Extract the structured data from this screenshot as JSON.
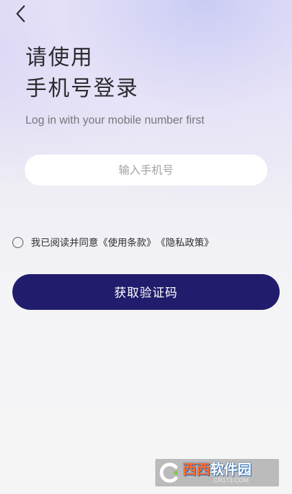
{
  "header": {
    "back_icon": "chevron-left-icon"
  },
  "title": {
    "line1": "请使用",
    "line2": "手机号登录"
  },
  "subtitle": "Log in with your mobile number first",
  "phone_input": {
    "value": "",
    "placeholder": "输入手机号"
  },
  "agreement": {
    "checked": false,
    "prefix": "我已阅读并同意",
    "terms_link": "《使用条款》",
    "privacy_link": "《隐私政策》"
  },
  "get_code_button": {
    "label": "获取验证码"
  },
  "colors": {
    "primary": "#211d6c",
    "background_top": "#d9d6f5",
    "background_bottom": "#f5f5f6",
    "placeholder": "#a2a2a6"
  },
  "watermark": {
    "part1": "西西",
    "part2": "软件园",
    "site": "CR173.COM"
  }
}
